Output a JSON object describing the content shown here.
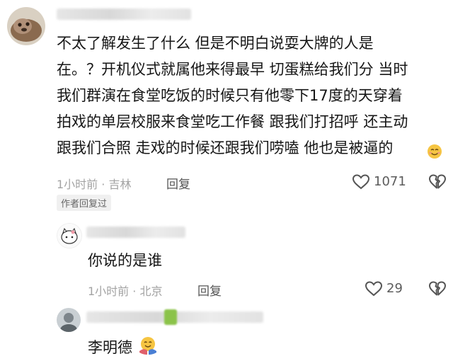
{
  "comment": {
    "lines": [
      "不太了解发生了什么 但是不明白说耍大牌的人是",
      "在。？开机仪式就属他来得最早 切蛋糕给我们分 当时",
      "我们群演在食堂吃饭的时候只有他零下17度的天穿着",
      "拍戏的单层校服来食堂吃工作餐 跟我们打招呼 还主动",
      "跟我们合照 走戏的时候还跟我们唠嗑 他也是被逼的"
    ],
    "time_location": "1小时前 · 吉林",
    "reply_label": "回复",
    "like_count": "1071",
    "author_replied_badge": "作者回复过"
  },
  "replies": [
    {
      "text": "你说的是谁",
      "time_location": "1小时前 · 北京",
      "reply_label": "回复",
      "like_count": "29"
    },
    {
      "text": "李明德"
    }
  ],
  "colors": {
    "text": "#161616",
    "meta": "#a3a3a3",
    "icon": "#555555"
  },
  "icons": [
    "heart-outline-icon",
    "broken-heart-icon",
    "smile-emoji-icon",
    "hug-emoji-icon"
  ]
}
